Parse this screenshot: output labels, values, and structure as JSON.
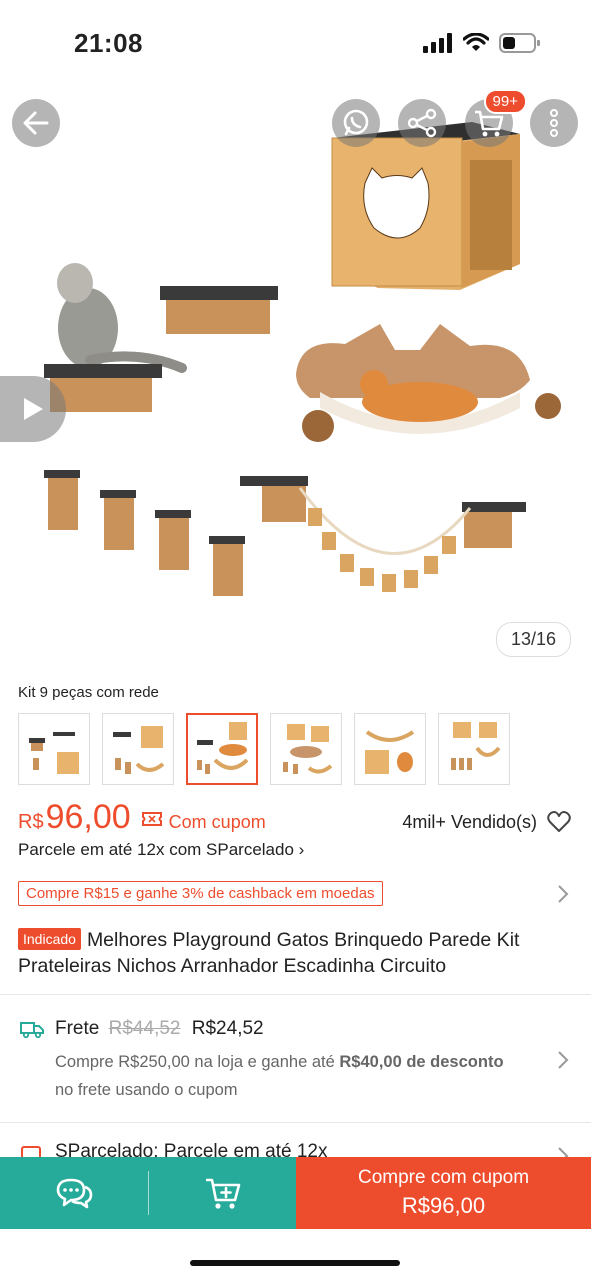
{
  "status_bar": {
    "time": "21:08"
  },
  "gallery": {
    "counter": "13/16",
    "cart_badge": "99+"
  },
  "variation": {
    "label": "Kit 9 peças com rede",
    "thumbnails": [
      "thumb-1",
      "thumb-2",
      "thumb-3",
      "thumb-4",
      "thumb-5",
      "thumb-6"
    ],
    "selected_index": 2
  },
  "price": {
    "currency": "R$",
    "value": "96,00",
    "coupon_text": "Com cupom",
    "sold": "4mil+ Vendido(s)",
    "installment": "Parcele em até 12x com SParcelado ›"
  },
  "cashback": {
    "text": "Compre R$15 e ganhe 3% de cashback em moedas"
  },
  "product": {
    "tag": "Indicado",
    "title": "Melhores Playground Gatos Brinquedo Parede Kit Prateleiras Nichos Arranhador Escadinha Circuito"
  },
  "shipping": {
    "label": "Frete",
    "old_price": "R$44,52",
    "new_price": "R$24,52",
    "desc_prefix": "Compre R$250,00 na loja e ganhe até ",
    "desc_bold": "R$40,00 de desconto",
    "desc_suffix": " no frete usando o cupom"
  },
  "sparcelado": {
    "text": "SParcelado: Parcele em até 12x"
  },
  "bottom_bar": {
    "buy_label": "Compre com cupom",
    "buy_price": "R$96,00"
  },
  "colors": {
    "accent": "#ee4d2d",
    "teal": "#26aa99"
  }
}
